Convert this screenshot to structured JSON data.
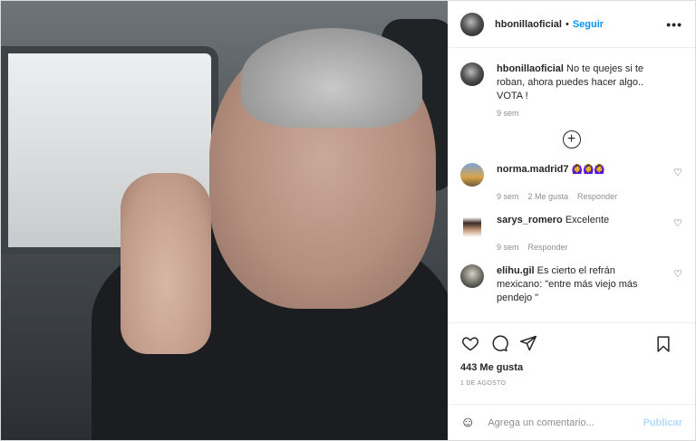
{
  "post": {
    "username": "hbonillaoficial",
    "follow_label": "Seguir",
    "more_label": "•••",
    "caption": "No te quejes si te roban, ahora puedes hacer algo.. VOTA !",
    "caption_time": "9 sem",
    "load_more_icon": "plus-circle-icon"
  },
  "comments": [
    {
      "username": "norma.madrid7",
      "text": "🙆‍♀️🙆‍♀️🙆‍♀️",
      "time": "9 sem",
      "likes": "2 Me gusta",
      "reply": "Responder"
    },
    {
      "username": "sarys_romero",
      "text": "Excelente",
      "time": "9 sem",
      "reply": "Responder"
    },
    {
      "username": "elihu.gil",
      "text": "Es cierto el refrán mexicano: \"entre más viejo más pendejo \""
    }
  ],
  "actions": {
    "like_icon": "heart-icon",
    "comment_icon": "comment-icon",
    "share_icon": "share-icon",
    "save_icon": "bookmark-icon"
  },
  "likes_count": "443 Me gusta",
  "date": "1 DE AGOSTO",
  "composer": {
    "placeholder": "Agrega un comentario...",
    "publish_label": "Publicar",
    "emoji_icon": "smile-icon"
  }
}
